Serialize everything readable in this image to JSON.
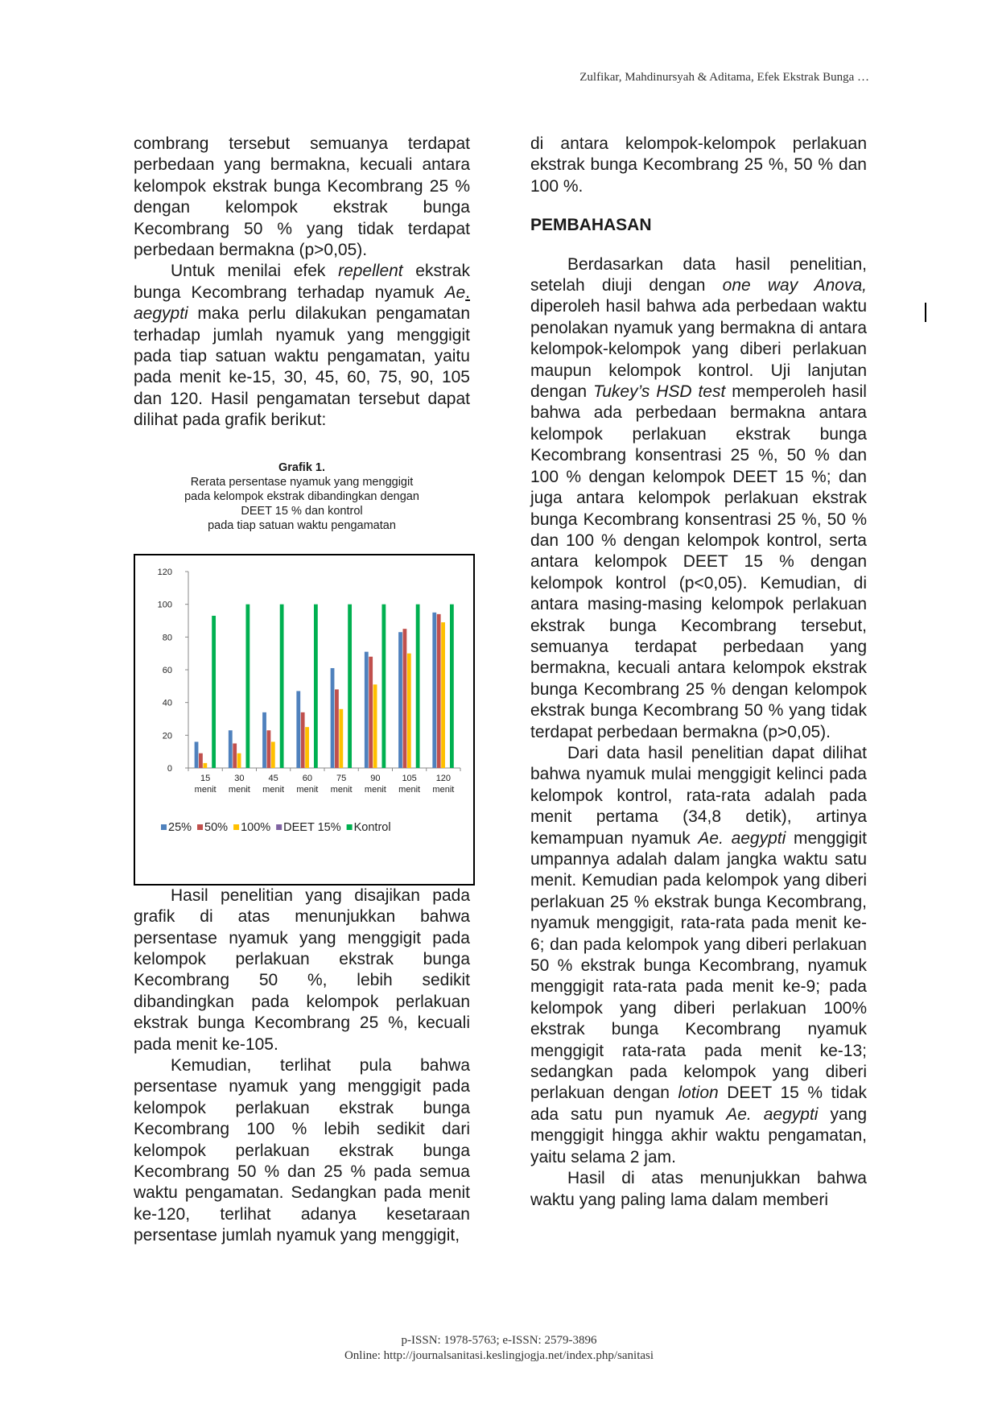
{
  "running_head": "Zulfikar, Mahdinursyah & Aditama, Efek Ekstrak Bunga …",
  "left_column": {
    "p1": "combrang tersebut semuanya terdapat perbedaan yang bermakna, kecuali antara kelompok ekstrak bunga Kecombrang 25 % dengan kelompok ekstrak bunga Kecombrang 50 %  yang tidak terdapat perbedaan bermakna (p>0,05).",
    "p2": {
      "a": "Untuk menilai efek ",
      "b": "repellent",
      "c": " ekstrak bunga Kecombrang terhadap nyamuk ",
      "d": "Ae",
      "e": ".",
      "f": " aegypti",
      "g": " maka perlu dilakukan pengamatan terhadap jumlah nyamuk yang menggigit pada tiap satuan waktu pengamatan, yaitu pada menit ke-15, 30, 45, 60, 75, 90, 105 dan 120. Hasil pengamatan tersebut dapat dilihat pada grafik berikut:"
    },
    "figure": {
      "label": "Grafik 1.",
      "line1": "Rerata persentase nyamuk yang menggigit",
      "line2": "pada kelompok ekstrak dibandingkan dengan",
      "line3": "DEET 15 % dan kontrol",
      "line4": "pada tiap satuan waktu pengamatan"
    },
    "p3": "Hasil penelitian yang disajikan pada grafik di atas menunjukkan bahwa persentase nyamuk yang menggigit pada kelompok perlakuan ekstrak bunga Kecombrang 50 %, lebih sedikit dibandingkan pada kelompok perlakuan ekstrak bunga Kecombrang 25 %, kecuali pada menit ke-105.",
    "p4": "Kemudian, terlihat pula bahwa persentase nyamuk yang menggigit pada kelompok perlakuan ekstrak bunga Kecombrang 100 % lebih sedikit dari kelompok perlakuan ekstrak bunga Kecombrang 50 % dan 25 % pada semua waktu pengamatan. Sedangkan pada menit ke-120, terlihat adanya kesetaraan persentase jumlah nyamuk yang menggigit,"
  },
  "right_column": {
    "p1": "di antara kelompok-kelompok perlakuan ekstrak bunga Kecombrang 25 %, 50 % dan 100 %.",
    "heading": "PEMBAHASAN",
    "p2": {
      "a": "Berdasarkan data hasil penelitian, setelah diuji dengan ",
      "b": "one way Anova,",
      "c": " diperoleh hasil bahwa ada perbedaan waktu penolakan nyamuk yang bermakna di antara kelompok-kelompok yang diberi perlakuan maupun kelompok kontrol. Uji lanjutan dengan ",
      "d": "Tukey’s HSD test",
      "e": " memperoleh hasil bahwa ada perbedaan bermakna antara kelompok perlakuan ekstrak bunga Kecombrang konsentrasi 25 %, 50 % dan 100 % dengan kelompok DEET 15 %; dan juga antara kelompok perlakuan ekstrak bunga Kecombrang konsentrasi 25 %, 50 % dan 100 % dengan kelompok kontrol, serta antara kelompok DEET 15 % dengan kelompok kontrol (p<0,05). Kemudian, di antara masing-masing kelompok perlakuan ekstrak bunga Kecombrang tersebut, semuanya terdapat perbedaan yang bermakna, kecuali antara kelompok ekstrak bunga Kecombrang 25 % dengan kelompok ekstrak bunga Kecombrang 50 % yang tidak terdapat perbedaan bermakna (p>0,05)."
    },
    "p3": {
      "a": "Dari data hasil penelitian dapat dilihat bahwa nyamuk mulai menggigit kelinci pada kelompok kontrol, rata-rata adalah pada menit pertama (34,8 detik), artinya kemampuan nyamuk ",
      "b": "Ae. aegypti",
      "c": " menggigit umpannya adalah dalam jangka waktu satu menit. Kemudian pada kelompok yang diberi perlakuan 25 % ekstrak bunga Kecombrang, nyamuk menggigit, rata-rata pada menit ke-6; dan pada kelompok yang diberi perlakuan 50 % ekstrak bunga Kecombrang, nyamuk menggigit rata-rata pada menit ke-9; pada kelompok yang diberi perlakuan 100% ekstrak bunga Kecombrang nyamuk menggigit rata-rata pada menit ke-13; sedangkan pada kelompok yang diberi perlakuan dengan ",
      "d": "lotion",
      "e": " DEET 15 % tidak ada satu pun nyamuk ",
      "f": "Ae. aegypti",
      "g": " yang menggigit hingga akhir waktu pengamatan, yaitu selama 2 jam."
    },
    "p4": "Hasil di atas menunjukkan bahwa waktu yang paling lama dalam memberi"
  },
  "footer": {
    "line1": "p-ISSN: 1978-5763; e-ISSN: 2579-3896",
    "line2": "Online: http://journalsanitasi.keslingjogja.net/index.php/sanitasi"
  },
  "chart_data": {
    "type": "bar",
    "categories": [
      [
        "15",
        "menit"
      ],
      [
        "30",
        "menit"
      ],
      [
        "45",
        "menit"
      ],
      [
        "60",
        "menit"
      ],
      [
        "75",
        "menit"
      ],
      [
        "90",
        "menit"
      ],
      [
        "105",
        "menit"
      ],
      [
        "120",
        "menit"
      ]
    ],
    "ylim": [
      0,
      120
    ],
    "yticks": [
      0,
      20,
      40,
      60,
      80,
      100,
      120
    ],
    "legend_position": "bottom",
    "grid": false,
    "series": [
      {
        "name": "25%",
        "color": "#4f81bd",
        "values": [
          16,
          23,
          34,
          47,
          61,
          71,
          83,
          95
        ]
      },
      {
        "name": "50%",
        "color": "#c0504d",
        "values": [
          9,
          15,
          23,
          34,
          48,
          68,
          85,
          94
        ]
      },
      {
        "name": "100%",
        "color": "#ffc000",
        "values": [
          3,
          9,
          16,
          25,
          36,
          51,
          70,
          89
        ]
      },
      {
        "name": "DEET 15%",
        "color": "#8064a2",
        "values": [
          0,
          0,
          0,
          0,
          0,
          0,
          0,
          0
        ]
      },
      {
        "name": "Kontrol",
        "color": "#00b050",
        "values": [
          93,
          100,
          100,
          100,
          100,
          100,
          100,
          100
        ]
      }
    ]
  }
}
